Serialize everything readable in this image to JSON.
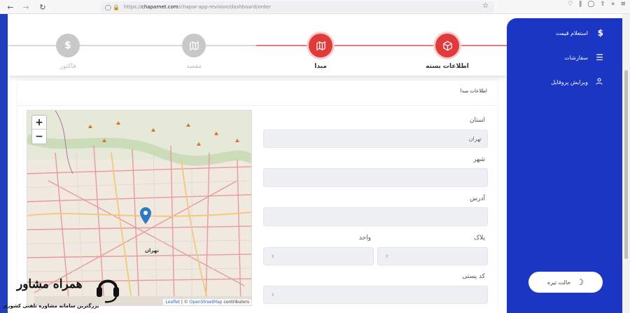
{
  "browser": {
    "url_prefix": "https://",
    "url_host": "chaparnet.com",
    "url_path": "/chapar-app-revision/dashboard/order"
  },
  "steps": [
    {
      "label": "اطلاعات بسته",
      "icon": "box-icon",
      "state": "active"
    },
    {
      "label": "مبدا",
      "icon": "map-icon",
      "state": "active"
    },
    {
      "label": "مقصد",
      "icon": "map-icon",
      "state": "inactive"
    },
    {
      "label": "فاکتور",
      "icon": "dollar-icon",
      "state": "inactive"
    }
  ],
  "colors": {
    "accent": "#e03a3a",
    "sidebar": "#1a36c2",
    "inactive": "#c8c8c8"
  },
  "sidebar": {
    "items": [
      {
        "label": "استعلام قیمت",
        "icon": "dollar-icon"
      },
      {
        "label": "سفارشات",
        "icon": "list-icon"
      },
      {
        "label": "ویرایش پروفایل",
        "icon": "user-icon"
      }
    ],
    "dark_mode_label": "حالت تیره"
  },
  "card": {
    "title": "اطلاعات مبدا"
  },
  "form": {
    "province_label": "استان",
    "province_value": "تهران",
    "city_label": "شهر",
    "city_value": "",
    "address_label": "آدرس",
    "address_value": "",
    "plaque_label": "پلاک",
    "unit_label": "واحد",
    "postal_label": "کد پستی"
  },
  "map": {
    "zoom_in": "+",
    "zoom_out": "−",
    "city_name": "تهران",
    "attribution_leaflet": "Leaflet",
    "attribution_sep": " | © ",
    "attribution_osm": "OpenStreetMap",
    "attribution_tail": " contributors"
  },
  "watermark": {
    "title": "همراه مشاور",
    "subtitle": "بزرگترین سامانه مشاوره تلفنی کشوری"
  }
}
